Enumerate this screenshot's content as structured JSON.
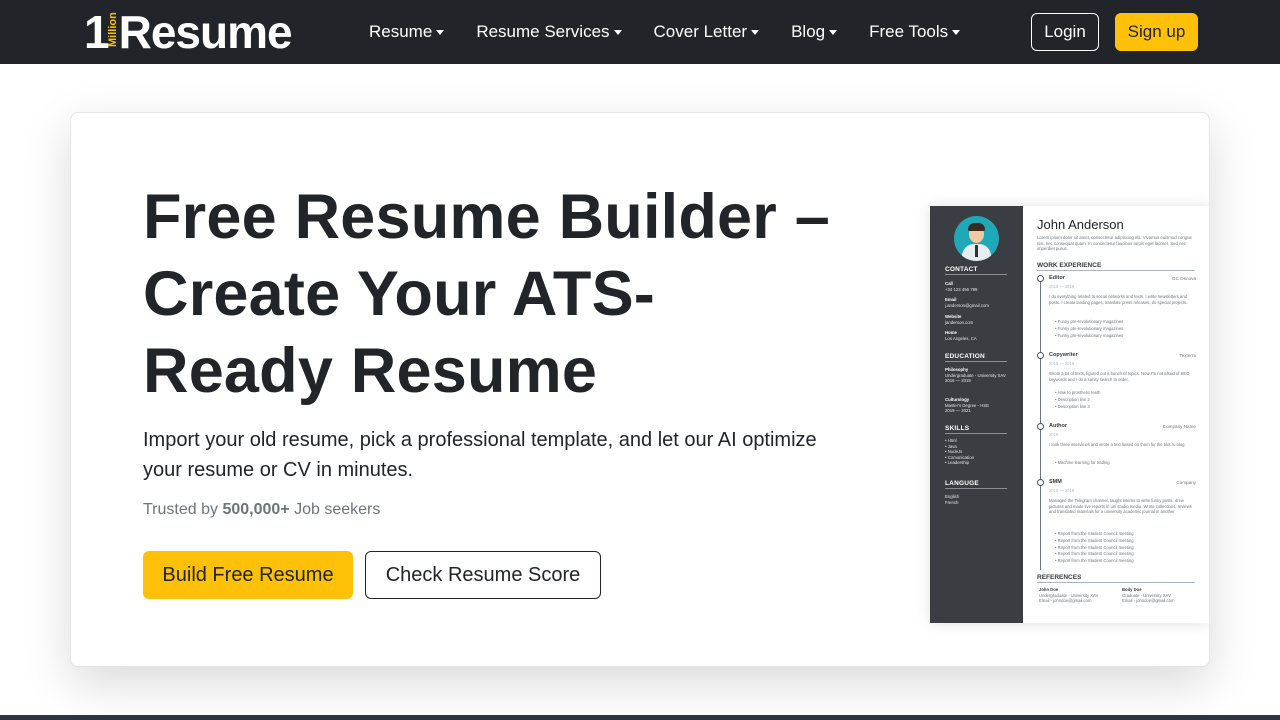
{
  "brand": {
    "one": "1",
    "million": "Million",
    "word": "Resume"
  },
  "nav": {
    "items": [
      {
        "label": "Resume"
      },
      {
        "label": "Resume Services"
      },
      {
        "label": "Cover Letter"
      },
      {
        "label": "Blog"
      },
      {
        "label": "Free Tools"
      }
    ],
    "login_label": "Login",
    "signup_label": "Sign up"
  },
  "colors": {
    "navbar": "#212529",
    "accent": "#ffc107"
  },
  "hero": {
    "title": "Free Resume Builder – Create Your ATS-Ready Resume",
    "subtitle": "Import your old resume, pick a professional template, and let our AI optimize your resume or CV in minutes.",
    "trust_prefix": "Trusted by",
    "trust_count": "500,000+",
    "trust_suffix": "Job seekers",
    "build_label": "Build Free Resume",
    "score_label": "Check Resume Score"
  },
  "resume_preview": {
    "name": "John Anderson",
    "intro": "Lorem ipsum dolor sit amet, consectetur adipiscing elit. Vivamus euismod congue nisi, nec consequat quam. In consectetur faucibus turpis eget laoreet. Sed nec imperdiet purus.",
    "sidebar": {
      "contact_title": "CONTACT",
      "call_label": "Call",
      "call_value": "+34 123 456 789",
      "email_label": "Email",
      "email_value": "j.anderson@gmail.com",
      "website_label": "Website",
      "website_value": "janderson.com",
      "home_label": "Home",
      "home_value": "Los Angeles, CA",
      "education_title": "EDUCATION",
      "edu1_label": "Philosophy",
      "edu1_value": "Undergraduate - University XAV",
      "edu1_years": "2016 — 2019",
      "edu2_label": "Culturology",
      "edu2_value": "Master's Degree - HSE",
      "edu2_years": "2019 — 2021",
      "skills_title": "SKILLS",
      "skills": [
        "Html",
        "Java",
        "NodeJs",
        "Comunication",
        "Leadership"
      ],
      "language_title": "LANGUGE",
      "languages": [
        "English",
        "French"
      ]
    },
    "work_title": "WORK EXPERIENCE",
    "jobs": [
      {
        "role": "Editor",
        "company": "GC Osnova",
        "dates": "2019 — 2019",
        "text": "I do everything related to social networks and texts. I write newsletters and posts. I create landing pages, translate press releases, do special projects.",
        "bullets": [
          "Funny pre-revolutionary magazines",
          "Funny pre-revolutionary magazines",
          "Funny pre-revolutionary magazines"
        ]
      },
      {
        "role": "Copywriter",
        "company": "Texterra",
        "dates": "2019 — 2019",
        "text": "Wrote a lot of texts, figured out a bunch of topics. Now I'm not afraid of SEO keywords and I do a sanity search to order.",
        "bullets": [
          "How to prosthetic teeth",
          "Description line 2",
          "Description line 3"
        ]
      },
      {
        "role": "Author",
        "company": "Company Name",
        "dates": "2019",
        "text": "I took three interviews and wrote a text based on them for the blot.ru blog.",
        "bullets": [
          "Machine learning for trading"
        ]
      },
      {
        "role": "SMM",
        "company": "Company",
        "dates": "2019 — 2019",
        "text": "Managed the Telegram channel, taught interns to write funny posts, drew pictures and made live reports in uni studio media. Wrote collections, reviews and translated materials for a university academic journal in another",
        "bullets": [
          "Report from the Student Council meeting",
          "Report from the Student Council meeting",
          "Report from the Student Council meeting",
          "Report from the Student Council meeting",
          "Report from the Student Council meeting"
        ]
      }
    ],
    "references_title": "REFERENCES",
    "references": [
      {
        "name": "John Doe",
        "line1": "Undergraduate - University XAV",
        "line2": "Email - johndoe@gmail.com"
      },
      {
        "name": "Body Doe",
        "line1": "Graduate - University XAV",
        "line2": "Email - johndoe@gmail.com"
      }
    ]
  }
}
